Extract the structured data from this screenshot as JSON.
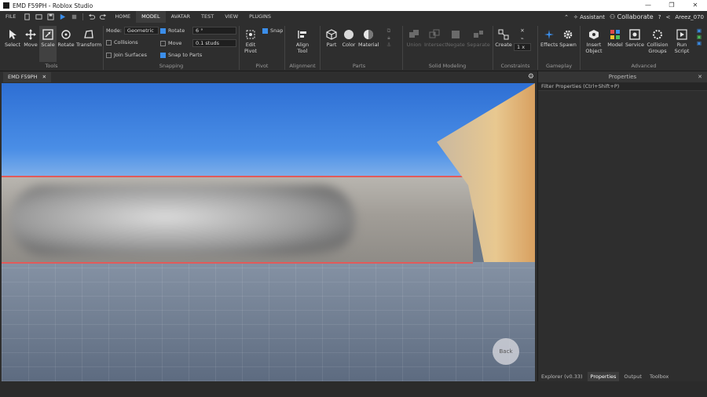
{
  "window": {
    "title": "EMD F59PH - Roblox Studio",
    "controls": [
      "—",
      "❐",
      "✕"
    ]
  },
  "menubar": {
    "file": "FILE",
    "tabs": [
      "HOME",
      "MODEL",
      "AVATAR",
      "TEST",
      "VIEW",
      "PLUGINS"
    ],
    "active_tab": "MODEL",
    "assistant": "Assistant",
    "collaborate": "Collaborate",
    "username": "Areez_070"
  },
  "ribbon": {
    "tools": {
      "label": "Tools",
      "items": [
        "Select",
        "Move",
        "Scale",
        "Rotate",
        "Transform"
      ]
    },
    "snapping": {
      "label": "Snapping",
      "mode_label": "Mode:",
      "mode_value": "Geometric",
      "collisions": "Collisions",
      "join_surfaces": "Join Surfaces",
      "rotate": "Rotate",
      "rotate_value": "6 °",
      "move": "Move",
      "move_value": "0.1 studs",
      "snap_to_parts": "Snap to Parts"
    },
    "pivot": {
      "label": "Pivot",
      "edit": "Edit Pivot",
      "snap": "Snap"
    },
    "alignment": {
      "label": "Alignment",
      "align_tool": "Align Tool"
    },
    "parts": {
      "label": "Parts",
      "items": [
        "Part",
        "Color",
        "Material"
      ]
    },
    "solid_modeling": {
      "label": "Solid Modeling",
      "items": [
        "Union",
        "Intersect",
        "Negate",
        "Separate"
      ]
    },
    "constraints": {
      "label": "Constraints",
      "create": "Create",
      "scale": "1 x"
    },
    "gameplay": {
      "label": "Gameplay",
      "items": [
        "Effects",
        "Spawn"
      ]
    },
    "advanced": {
      "label": "Advanced",
      "items": [
        "Insert Object",
        "Model",
        "Service",
        "Collision Groups",
        "Run Script"
      ]
    }
  },
  "document": {
    "tab_title": "EMD F59PH",
    "close": "✕"
  },
  "viewport": {
    "back_button": "Back"
  },
  "properties_panel": {
    "title": "Properties",
    "filter_placeholder": "Filter Properties (Ctrl+Shift+P)",
    "tabs": [
      "Explorer (v0.33)",
      "Properties",
      "Output",
      "Toolbox"
    ],
    "active_tab": "Properties"
  },
  "colors": {
    "accent": "#3b8eea",
    "dark_bg": "#2e2e2e"
  }
}
